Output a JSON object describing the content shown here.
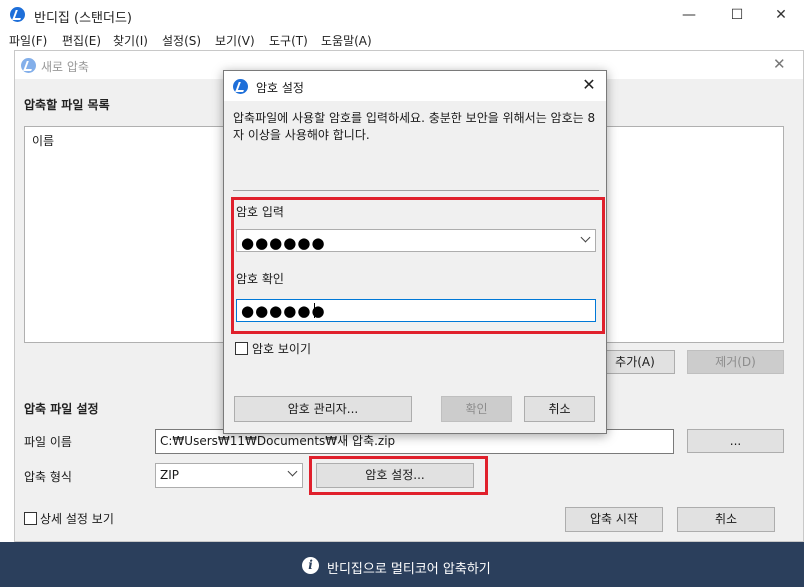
{
  "main_window": {
    "title": "반디집 (스탠더드)",
    "controls": {
      "minimize": "—",
      "maximize": "☐",
      "close": "✕"
    }
  },
  "menu": [
    "파일(F)",
    "편집(E)",
    "찾기(I)",
    "설정(S)",
    "보기(V)",
    "도구(T)",
    "도움말(A)"
  ],
  "new_archive": {
    "title": "새로 압축",
    "file_list_label": "압축할 파일 목록",
    "column_name": "이름",
    "add_button": "추가(A)",
    "remove_button": "제거(D)",
    "settings_label": "압축 파일 설정",
    "filename_label": "파일 이름",
    "filename_value": "C:₩Users₩11₩Documents₩새 압축.zip",
    "browse_button": "...",
    "format_label": "압축 형식",
    "format_value": "ZIP",
    "password_button": "암호 설정...",
    "advanced_label": "상세 설정 보기",
    "start_button": "압축 시작",
    "cancel_button": "취소"
  },
  "status_bar": {
    "message": "반디집으로 멀티코어 압축하기"
  },
  "password_dialog": {
    "title": "암호 설정",
    "description": "압축파일에 사용할 암호를 입력하세요. 충분한 보안을 위해서는 암호는 8자 이상을 사용해야 합니다.",
    "enter_label": "암호 입력",
    "enter_value": "●●●●●●",
    "confirm_label": "암호 확인",
    "confirm_value": "●●●●●●",
    "show_password_label": "암호 보이기",
    "manager_button": "암호 관리자...",
    "ok_button": "확인",
    "cancel_button": "취소"
  },
  "colors": {
    "accent_highlight": "#e0202c",
    "status_bar": "#2b3f5c",
    "focus_border": "#0078d7"
  }
}
